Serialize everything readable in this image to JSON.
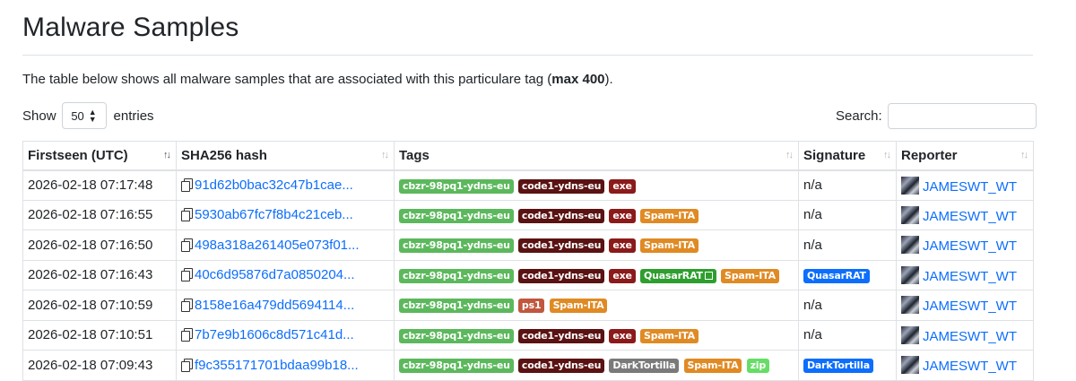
{
  "page": {
    "title": "Malware Samples",
    "intro_prefix": "The table below shows all malware samples that are associated with this particulare tag (",
    "intro_bold": "max 400",
    "intro_suffix": ")."
  },
  "controls": {
    "show_label": "Show",
    "entries_value": "50",
    "entries_label": "entries",
    "search_label": "Search:",
    "search_value": ""
  },
  "table": {
    "columns": [
      "Firstseen (UTC)",
      "SHA256 hash",
      "Tags",
      "Signature",
      "Reporter"
    ],
    "sort_icons": [
      "↑↓",
      "↑↓",
      "↑↓",
      "↑↓",
      "↑↓"
    ],
    "rows": [
      {
        "firstseen": "2026-02-18 07:17:48",
        "hash": "91d62b0bac32c47b1cae...",
        "tags": [
          {
            "text": "cbzr-98pq1-ydns-eu",
            "color": "#5cb85c"
          },
          {
            "text": "code1-ydns-eu",
            "color": "#5a1212"
          },
          {
            "text": "exe",
            "color": "#8b1a1a"
          }
        ],
        "signature": "n/a",
        "reporter": "JAMESWT_WT"
      },
      {
        "firstseen": "2026-02-18 07:16:55",
        "hash": "5930ab67fc7f8b4c21ceb...",
        "tags": [
          {
            "text": "cbzr-98pq1-ydns-eu",
            "color": "#5cb85c"
          },
          {
            "text": "code1-ydns-eu",
            "color": "#5a1212"
          },
          {
            "text": "exe",
            "color": "#8b1a1a"
          },
          {
            "text": "Spam-ITA",
            "color": "#e08a24"
          }
        ],
        "signature": "n/a",
        "reporter": "JAMESWT_WT"
      },
      {
        "firstseen": "2026-02-18 07:16:50",
        "hash": "498a318a261405e073f01...",
        "tags": [
          {
            "text": "cbzr-98pq1-ydns-eu",
            "color": "#5cb85c"
          },
          {
            "text": "code1-ydns-eu",
            "color": "#5a1212"
          },
          {
            "text": "exe",
            "color": "#8b1a1a"
          },
          {
            "text": "Spam-ITA",
            "color": "#e08a24"
          }
        ],
        "signature": "n/a",
        "reporter": "JAMESWT_WT"
      },
      {
        "firstseen": "2026-02-18 07:16:43",
        "hash": "40c6d95876d7a0850204...",
        "tags": [
          {
            "text": "cbzr-98pq1-ydns-eu",
            "color": "#5cb85c"
          },
          {
            "text": "code1-ydns-eu",
            "color": "#5a1212"
          },
          {
            "text": "exe",
            "color": "#8b1a1a"
          },
          {
            "text": "QuasarRAT",
            "color": "#2e9e2e",
            "external": true
          },
          {
            "text": "Spam-ITA",
            "color": "#e08a24"
          }
        ],
        "signature": "QuasarRAT",
        "signature_badge": true,
        "reporter": "JAMESWT_WT"
      },
      {
        "firstseen": "2026-02-18 07:10:59",
        "hash": "8158e16a479dd5694114...",
        "tags": [
          {
            "text": "cbzr-98pq1-ydns-eu",
            "color": "#5cb85c"
          },
          {
            "text": "ps1",
            "color": "#c0573e"
          },
          {
            "text": "Spam-ITA",
            "color": "#e08a24"
          }
        ],
        "signature": "n/a",
        "reporter": "JAMESWT_WT"
      },
      {
        "firstseen": "2026-02-18 07:10:51",
        "hash": "7b7e9b1606c8d571c41d...",
        "tags": [
          {
            "text": "cbzr-98pq1-ydns-eu",
            "color": "#5cb85c"
          },
          {
            "text": "code1-ydns-eu",
            "color": "#5a1212"
          },
          {
            "text": "exe",
            "color": "#8b1a1a"
          },
          {
            "text": "Spam-ITA",
            "color": "#e08a24"
          }
        ],
        "signature": "n/a",
        "reporter": "JAMESWT_WT"
      },
      {
        "firstseen": "2026-02-18 07:09:43",
        "hash": "f9c355171701bdaa99b18...",
        "tags": [
          {
            "text": "cbzr-98pq1-ydns-eu",
            "color": "#5cb85c"
          },
          {
            "text": "code1-ydns-eu",
            "color": "#5a1212"
          },
          {
            "text": "DarkTortilla",
            "color": "#7a7a7a"
          },
          {
            "text": "Spam-ITA",
            "color": "#e08a24"
          },
          {
            "text": "zip",
            "color": "#66dd66"
          }
        ],
        "signature": "DarkTortilla",
        "signature_badge": true,
        "reporter": "JAMESWT_WT"
      }
    ]
  },
  "colors": {
    "link": "#0d6efd",
    "signature_badge": "#0d6efd"
  },
  "icons": {
    "copy": "copy-icon",
    "avatar": "reporter-avatar",
    "external": "external-link-icon",
    "sort": "sort-icon"
  }
}
